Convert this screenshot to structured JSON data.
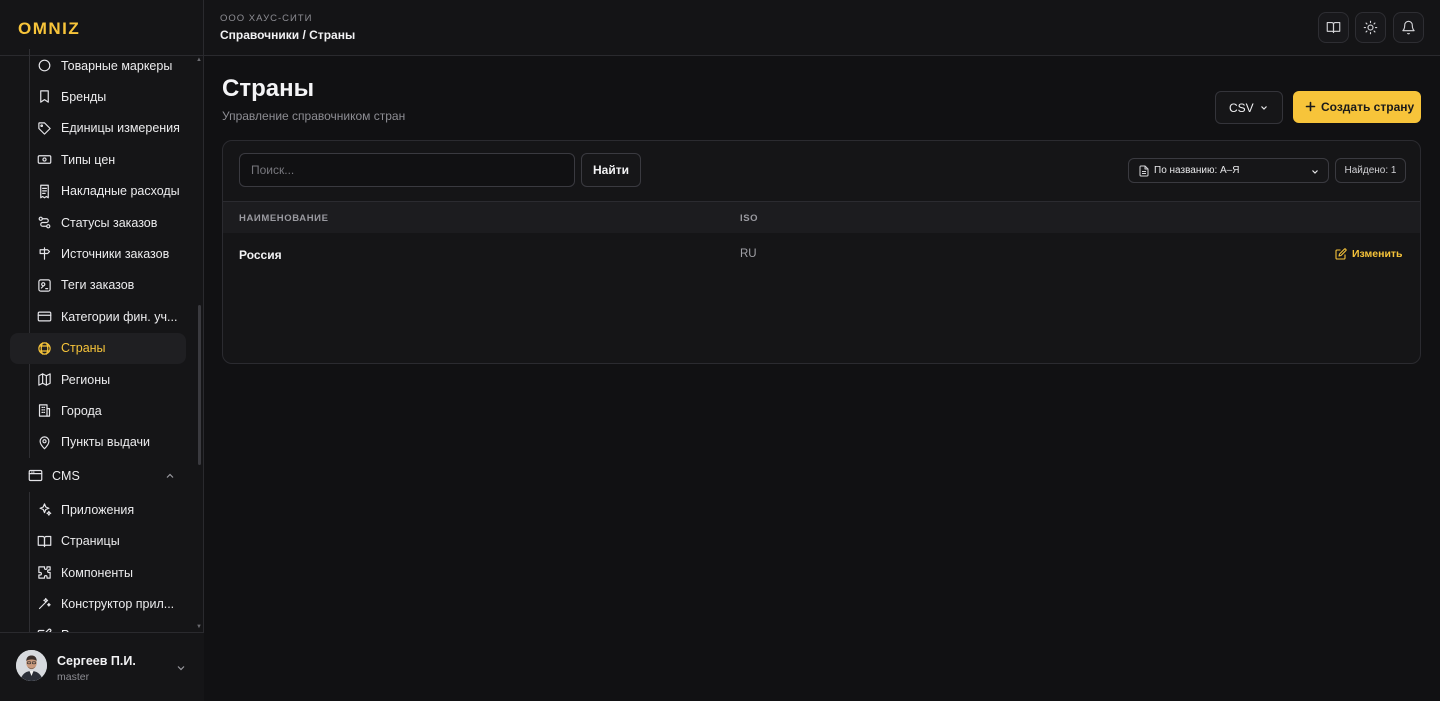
{
  "app": {
    "logo_text": "OMNIZ"
  },
  "header": {
    "org": "ООО ХАУС-СИТИ",
    "breadcrumb": "Справочники / Страны",
    "buttons": [
      {
        "name": "book-icon"
      },
      {
        "name": "sun-icon"
      },
      {
        "name": "bell-icon"
      }
    ]
  },
  "sidebar": {
    "items": [
      {
        "label": "Товарные маркеры",
        "icon": "circle-icon"
      },
      {
        "label": "Бренды",
        "icon": "bookmark-icon"
      },
      {
        "label": "Единицы измерения",
        "icon": "tag-icon"
      },
      {
        "label": "Типы цен",
        "icon": "banknote-icon"
      },
      {
        "label": "Накладные расходы",
        "icon": "receipt-icon"
      },
      {
        "label": "Статусы заказов",
        "icon": "route-icon"
      },
      {
        "label": "Источники заказов",
        "icon": "signpost-icon"
      },
      {
        "label": "Теги заказов",
        "icon": "scan-icon"
      },
      {
        "label": "Категории фин. уч...",
        "icon": "card-icon"
      },
      {
        "label": "Страны",
        "icon": "globe-icon",
        "active": true
      },
      {
        "label": "Регионы",
        "icon": "map-icon"
      },
      {
        "label": "Города",
        "icon": "building-icon"
      },
      {
        "label": "Пункты выдачи",
        "icon": "pin-icon"
      }
    ],
    "group": {
      "label": "CMS",
      "icon": "window-icon"
    },
    "cms_items": [
      {
        "label": "Приложения",
        "icon": "sparkles-icon"
      },
      {
        "label": "Страницы",
        "icon": "book-open-icon"
      },
      {
        "label": "Компоненты",
        "icon": "puzzle-icon"
      },
      {
        "label": "Конструктор прил...",
        "icon": "wand-icon"
      },
      {
        "label": "Редактор приложе...",
        "icon": "edit-icon"
      }
    ]
  },
  "user": {
    "name": "Сергеев П.И.",
    "role": "master"
  },
  "page": {
    "title": "Страны",
    "subtitle": "Управление справочником стран",
    "csv_label": "CSV",
    "create_label": "Создать страну"
  },
  "toolbar": {
    "search_placeholder": "Поиск...",
    "find_label": "Найти",
    "sort_label": "По названию: А–Я",
    "found_label": "Найдено: 1"
  },
  "table": {
    "columns": [
      "НАИМЕНОВАНИЕ",
      "ISO"
    ],
    "rows": [
      {
        "name": "Россия",
        "iso": "RU",
        "action": "Изменить"
      }
    ]
  },
  "colors": {
    "accent": "#f7c43a",
    "bg": "#111113",
    "panel": "#151517"
  }
}
